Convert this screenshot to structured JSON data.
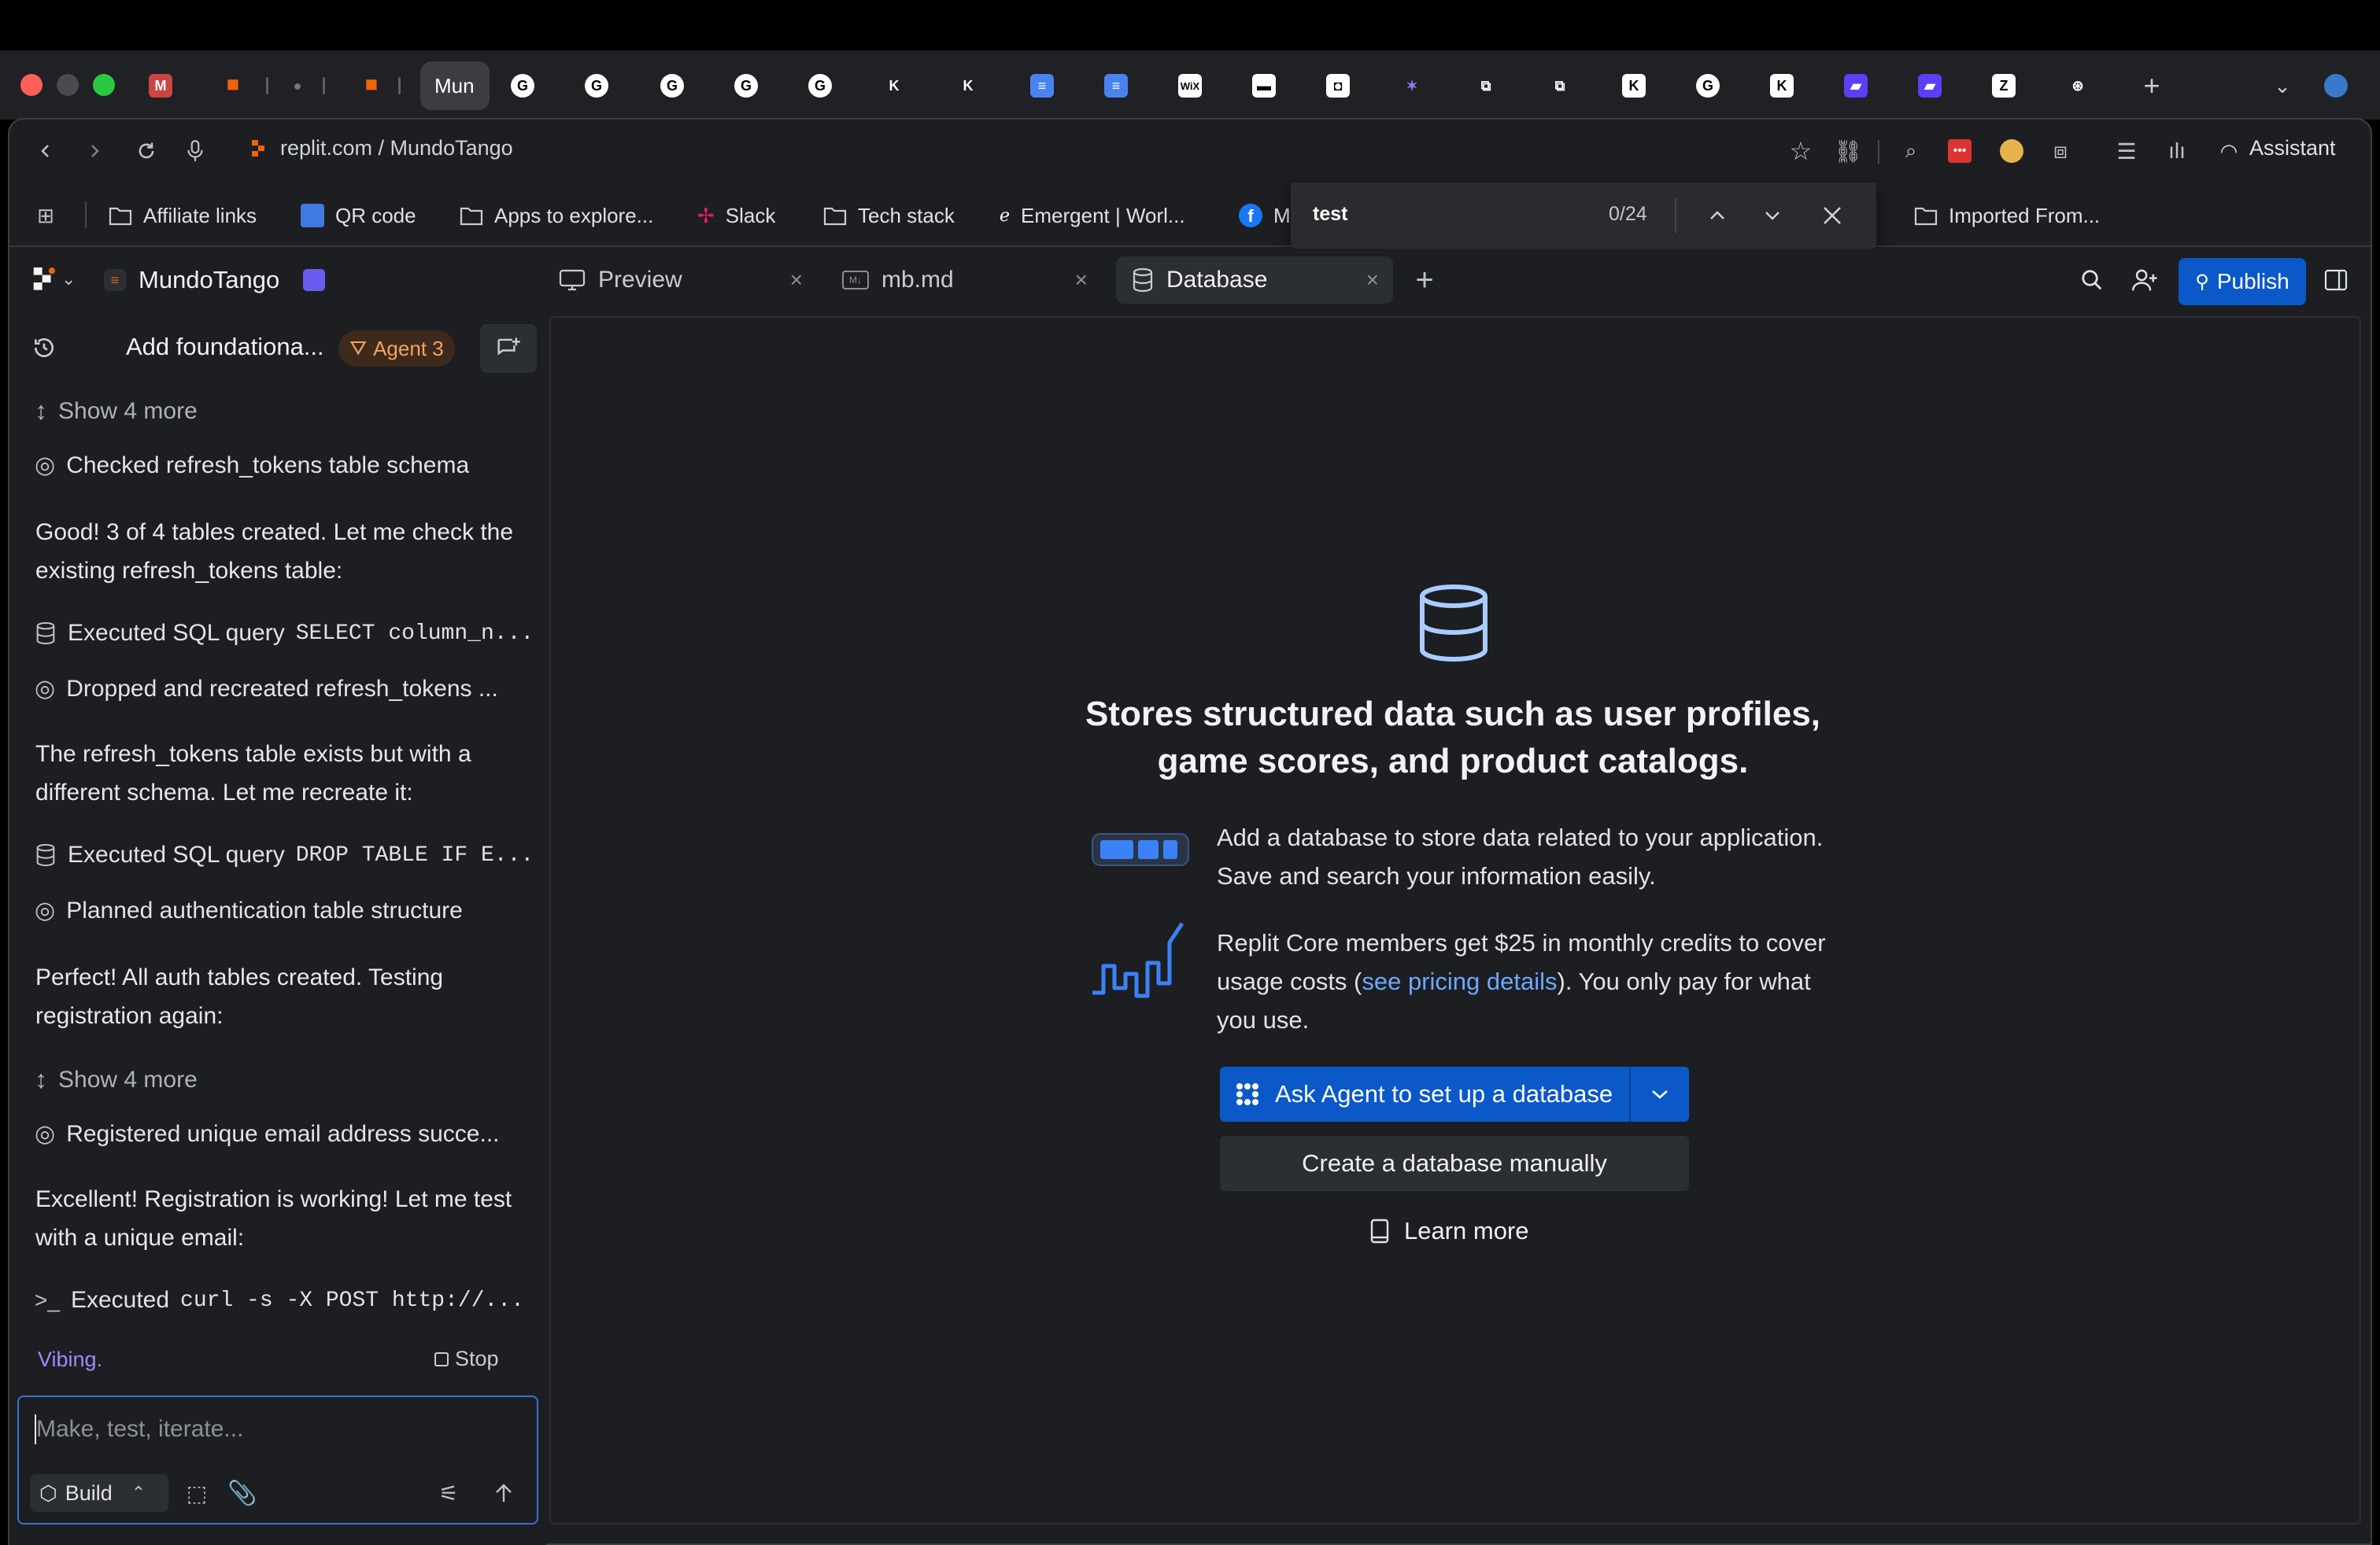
{
  "browser": {
    "active_tab_label": "Mun",
    "url": "replit.com / MundoTango",
    "assistant_label": "Assistant",
    "bookmarks": [
      {
        "label": "Affiliate links",
        "icon": "folder-icon"
      },
      {
        "label": "QR code",
        "icon": "qr-icon"
      },
      {
        "label": "Apps to explore...",
        "icon": "folder-icon"
      },
      {
        "label": "Slack",
        "icon": "slack-icon"
      },
      {
        "label": "Tech stack",
        "icon": "folder-icon"
      },
      {
        "label": "Emergent | Worl...",
        "icon": "emergent-icon"
      },
      {
        "label": "M",
        "icon": "facebook-icon"
      },
      {
        "label": "Imported From...",
        "icon": "folder-icon"
      }
    ]
  },
  "findbar": {
    "query": "test",
    "count": "0/24"
  },
  "replit": {
    "project_name": "MundoTango",
    "tabs": [
      {
        "label": "Preview",
        "icon": "monitor-icon"
      },
      {
        "label": "mb.md",
        "icon": "markdown-icon"
      },
      {
        "label": "Database",
        "icon": "database-icon"
      }
    ],
    "publish_label": "Publish"
  },
  "chat": {
    "thread_title": "Add foundationa...",
    "agent_badge": "Agent 3",
    "show_more_1": "Show 4 more",
    "step_checked": "Checked refresh_tokens table schema",
    "para_1": "Good! 3 of 4 tables created. Let me check the existing refresh_tokens table:",
    "sql_1_prefix": "Executed SQL query",
    "sql_1_code": "SELECT column_n...",
    "step_dropped": "Dropped and recreated refresh_tokens ...",
    "para_2": "The refresh_tokens table exists but with a different schema. Let me recreate it:",
    "sql_2_prefix": "Executed SQL query",
    "sql_2_code": "DROP TABLE IF E...",
    "step_planned": "Planned authentication table structure",
    "para_3": "Perfect! All auth tables created. Testing registration again:",
    "show_more_2": "Show 4 more",
    "step_registered": "Registered unique email address succe...",
    "para_4": "Excellent! Registration is working! Let me test with a unique email:",
    "curl_prefix": "Executed",
    "curl_code": "curl -s -X POST http://...",
    "status": "Vibing.",
    "stop_label": "Stop",
    "input_placeholder": "Make, test, iterate...",
    "build_label": "Build"
  },
  "database_panel": {
    "headline": "Stores structured data such as user profiles, game scores, and product catalogs.",
    "feature_1": "Add a database to store data related to your application. Save and search your information easily.",
    "feature_2_pre": "Replit Core members get $25 in monthly credits to cover usage costs (",
    "feature_2_link": "see pricing details",
    "feature_2_post": "). You only pay for what you use.",
    "ask_agent_label": "Ask Agent to set up a database",
    "create_manual_label": "Create a database manually",
    "learn_more_label": "Learn more"
  },
  "colors": {
    "accent": "#0b58c9",
    "link": "#6ea8ff",
    "agent_badge": "#f3a45b",
    "status": "#9d8cf8"
  }
}
